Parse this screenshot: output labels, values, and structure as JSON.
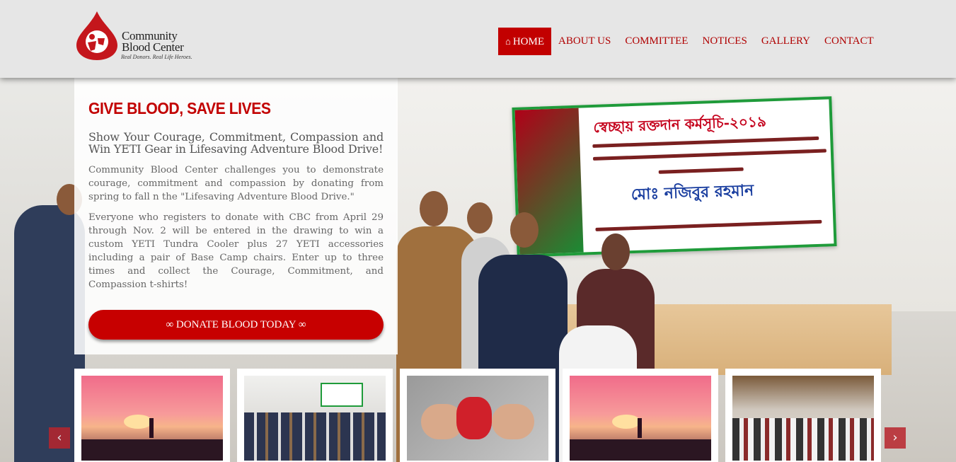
{
  "brand": {
    "name_line1": "Community",
    "name_line2": "Blood Center",
    "tagline": "Real Donors. Real Life Heroes.",
    "accent": "#c20000"
  },
  "nav": {
    "items": [
      {
        "label": "HOME",
        "active": true,
        "icon": "home-icon"
      },
      {
        "label": "ABOUT US",
        "active": false
      },
      {
        "label": "COMMITTEE",
        "active": false
      },
      {
        "label": "NOTICES",
        "active": false
      },
      {
        "label": "GALLERY",
        "active": false
      },
      {
        "label": "CONTACT",
        "active": false
      }
    ]
  },
  "hero": {
    "title": "GIVE BLOOD, SAVE LIVES",
    "subtitle": "Show Your Courage, Commitment, Compassion and Win YETI Gear in Lifesaving Adventure Blood Drive!",
    "paragraph1": "Community Blood Center challenges you to demonstrate courage, commitment and compassion by donating from spring to fall n the \"Lifesaving Adventure Blood Drive.\"",
    "paragraph2": "Everyone who registers to donate with CBC from April 29 through Nov. 2 will be entered in the drawing to win a custom YETI Tundra Cooler plus 27 YETI accessories including a pair of Base Camp chairs. Enter up to three times and collect the Courage, Commitment, and Compassion t-shirts!",
    "cta_label": "DONATE BLOOD TODAY",
    "cta_icon": "handshake-icon"
  },
  "background_banner": {
    "heading": "স্বেচ্ছায় রক্তদান কর্মসূচি-২০১৯",
    "guest": "মোঃ নজিবুর রহমান"
  },
  "gallery": {
    "thumbs": [
      {
        "name": "sunset"
      },
      {
        "name": "meeting"
      },
      {
        "name": "hands-heart"
      },
      {
        "name": "sunset"
      },
      {
        "name": "donation-hall"
      }
    ],
    "prev_icon": "chevron-left-icon",
    "next_icon": "chevron-right-icon"
  }
}
